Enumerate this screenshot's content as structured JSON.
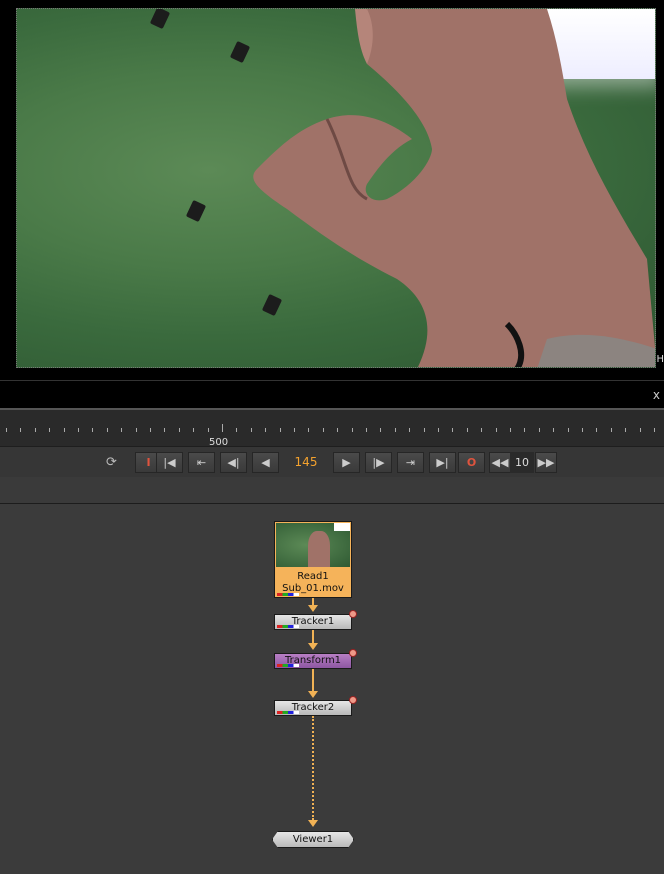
{
  "viewer": {
    "corner_label": "H"
  },
  "panel": {
    "close_label": "x"
  },
  "timeline": {
    "label_500": "500"
  },
  "transport": {
    "loop_icon": "loop-mode-icon",
    "in_point": "I",
    "out_point": "O",
    "current_frame": "145",
    "increment": "10"
  },
  "nodes": {
    "read": {
      "name": "Read1",
      "file": "Sub_01.mov"
    },
    "tracker1": {
      "label": "Tracker1"
    },
    "transform1": {
      "label": "Transform1"
    },
    "tracker2": {
      "label": "Tracker2"
    },
    "viewer": {
      "label": "Viewer1"
    }
  },
  "colors": {
    "accent": "#f4a22e",
    "connection": "#f1b255",
    "out_point": "#e0543e"
  }
}
